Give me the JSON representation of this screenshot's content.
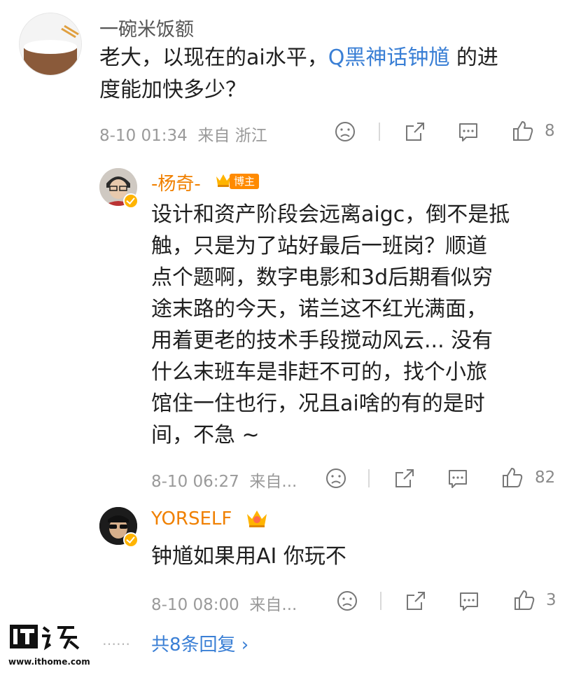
{
  "comment1": {
    "username": "一碗米饭额",
    "text_line1_a": "老大，以现在的ai水平，",
    "text_line1_link": "Q黑神话钟馗",
    "text_line1_b": " 的进",
    "text_line2": "度能加快多少？",
    "timestamp": "8-10 01:34",
    "location": "来自 浙江",
    "like_count": "8"
  },
  "reply1": {
    "username": "-杨奇-",
    "badge_label": "博主",
    "text_lines": [
      "设计和资产阶段会远离aigc，倒不是抵",
      "触，只是为了站好最后一班岗？顺道",
      "点个题啊，数字电影和3d后期看似穷",
      "途末路的今天，诺兰这不红光满面，",
      "用着更老的技术手段搅动风云... 没有",
      "什么末班车是非赶不可的，找个小旅",
      "馆住一住也行，况且ai啥的有的是时",
      "间，不急 ~"
    ],
    "timestamp": "8-10 06:27",
    "location": "来自...",
    "like_count": "82"
  },
  "reply2": {
    "username": "YORSELF",
    "text": "钟馗如果用AI 你玩不",
    "timestamp": "8-10 08:00",
    "location": "来自...",
    "like_count": "3"
  },
  "footer": {
    "dots": "……",
    "more_replies": "共8条回复 ›",
    "watermark_logo": "IT之家",
    "watermark_url": "www.ithome.com"
  },
  "colors": {
    "username_gray": "#555555",
    "username_orange": "#f08000",
    "link_blue": "#3a7fd5",
    "meta_gray": "#9a9a9a"
  },
  "icons": [
    "dislike-face-icon",
    "share-icon",
    "comment-icon",
    "like-thumb-icon",
    "crown-icon",
    "verified-icon"
  ]
}
